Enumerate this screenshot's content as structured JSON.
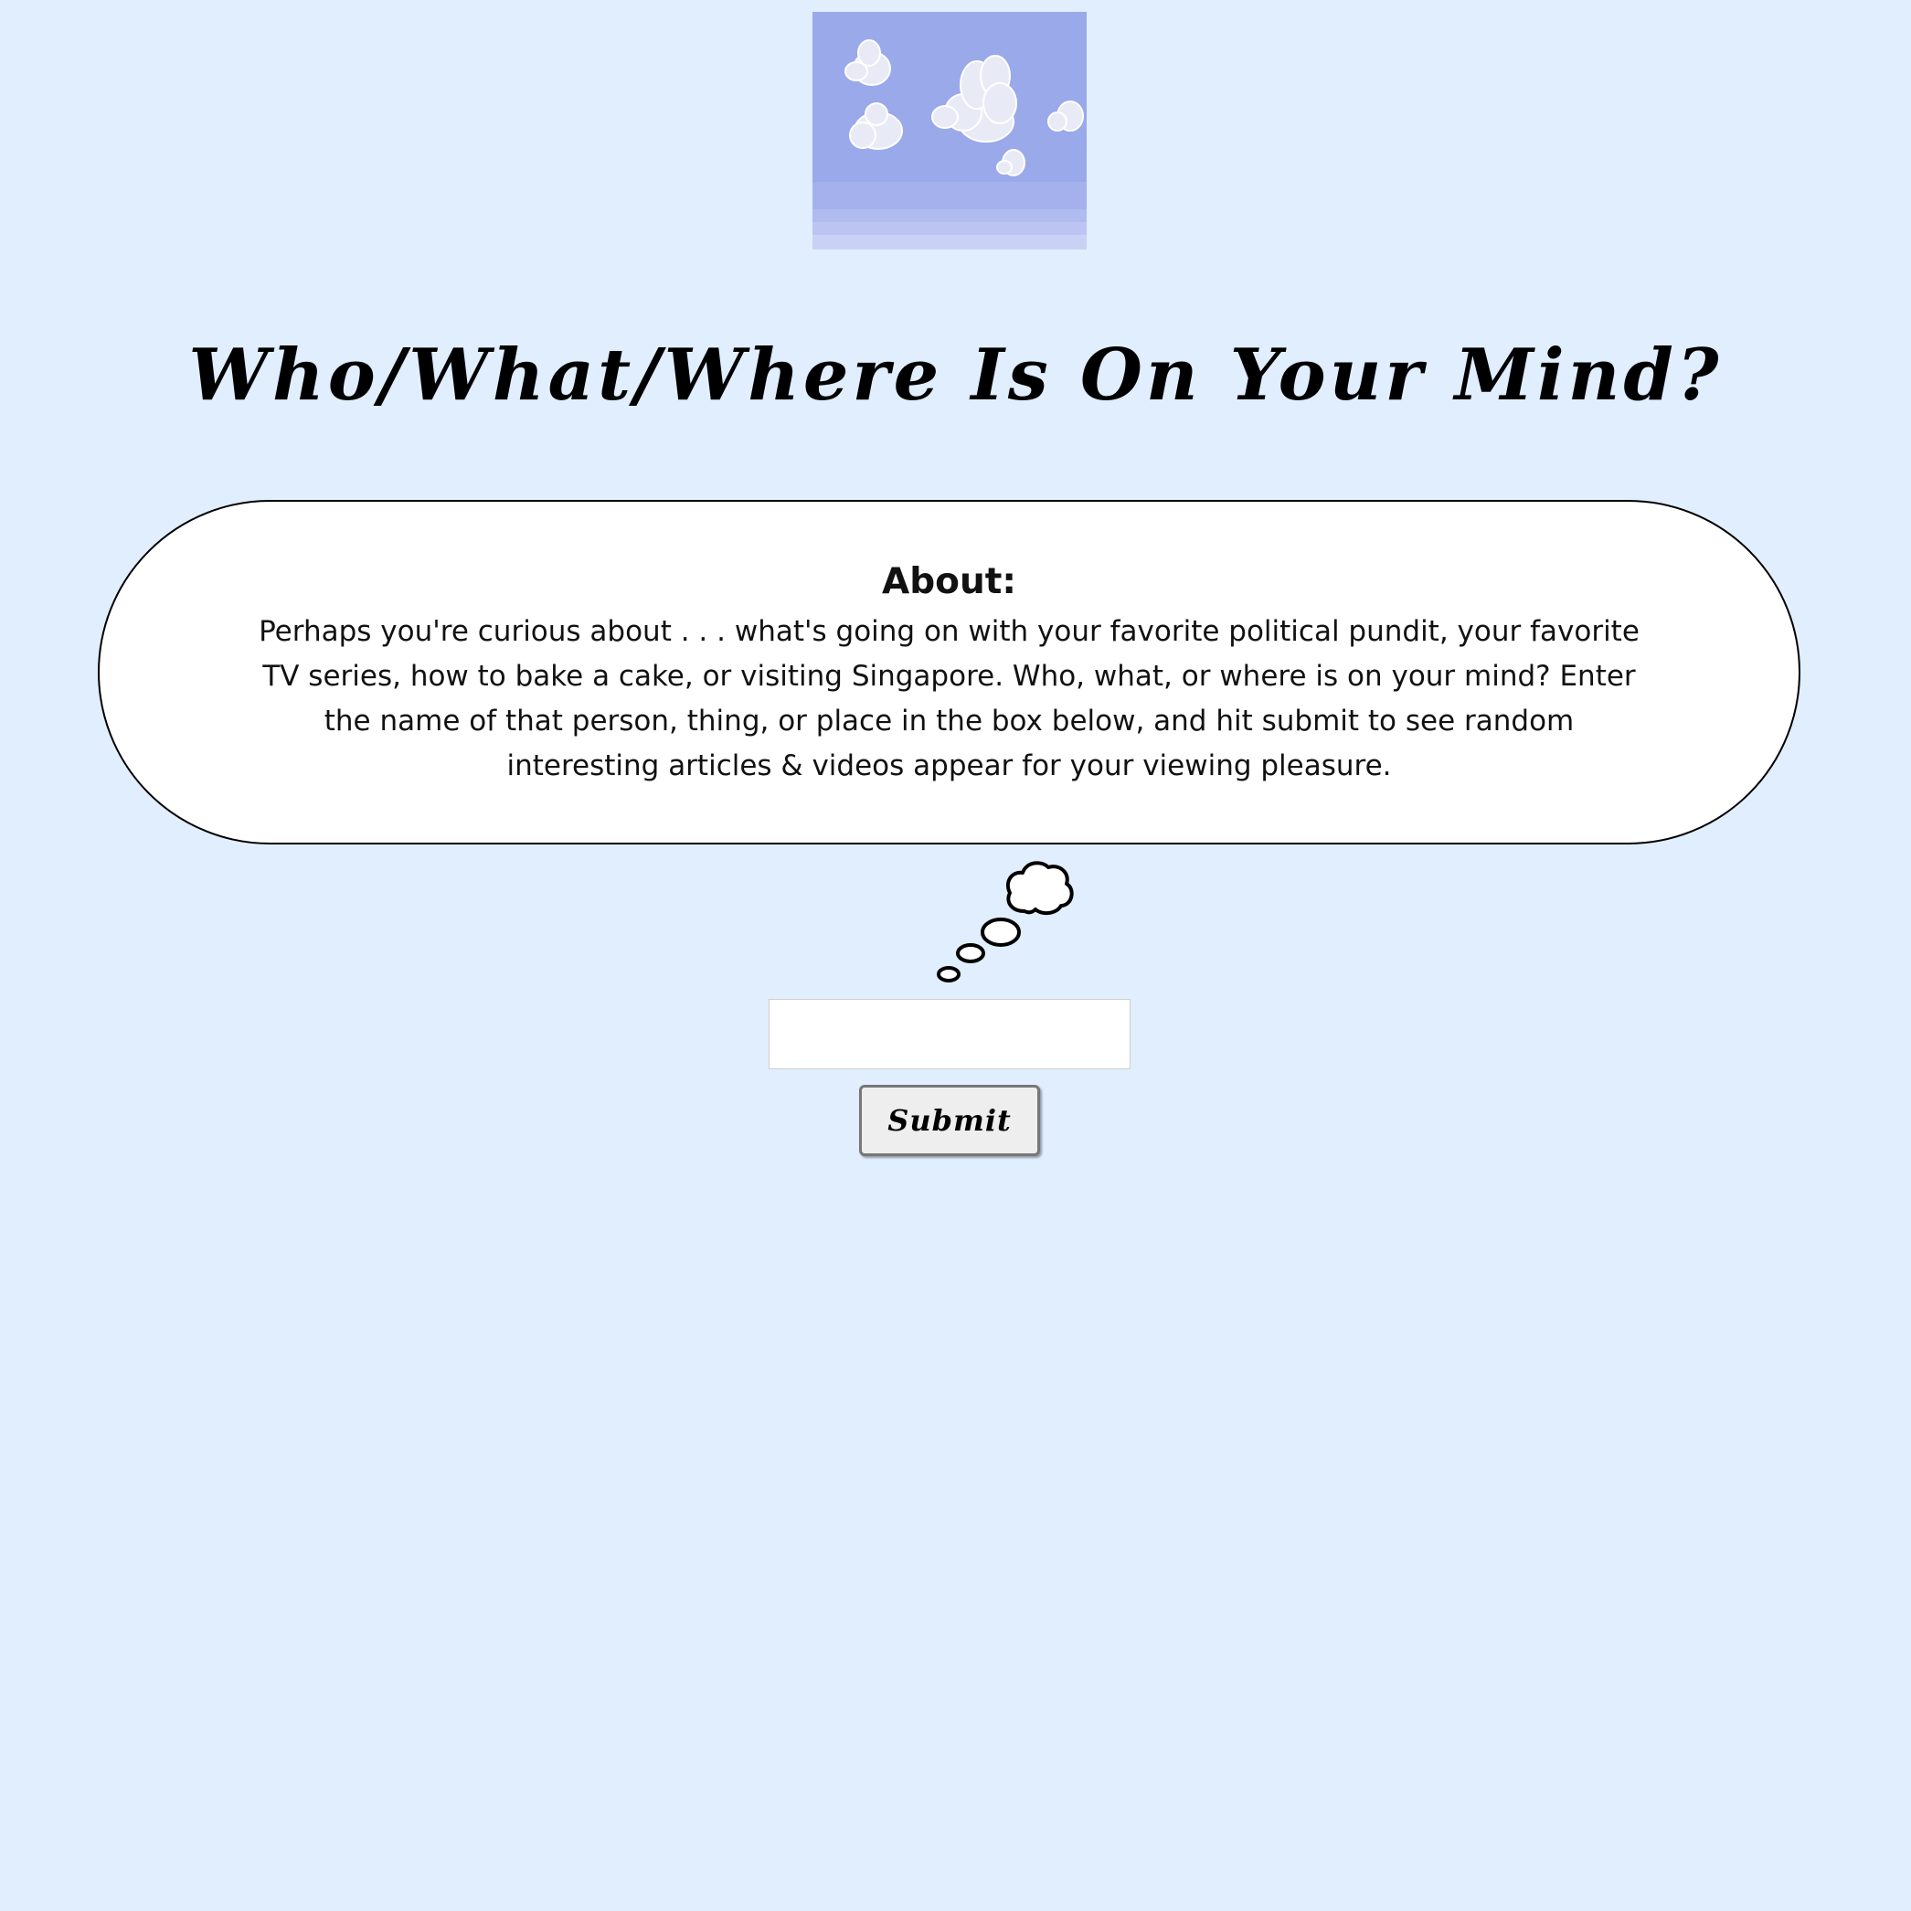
{
  "header": {
    "image_icon": "cloudy-sky-image",
    "title": "Who/What/Where Is On Your Mind?"
  },
  "about": {
    "heading": "About:",
    "text": "Perhaps you're curious about . . . what's going on with your favorite political pundit, your favorite TV series, how to bake a cake, or visiting Singapore. Who, what, or where is on your mind? Enter the name of that person, thing, or place in the box below, and hit submit to see random interesting articles & videos appear for your viewing pleasure."
  },
  "decorations": {
    "thought_tail_icon": "thought-bubble-tail-icon"
  },
  "search": {
    "value": "",
    "placeholder": ""
  },
  "submit": {
    "label": "Submit"
  },
  "colors": {
    "background": "#e0eefe",
    "sky": "#9aa9ea",
    "bubble": "#ffffff",
    "button": "#eeeeee"
  }
}
